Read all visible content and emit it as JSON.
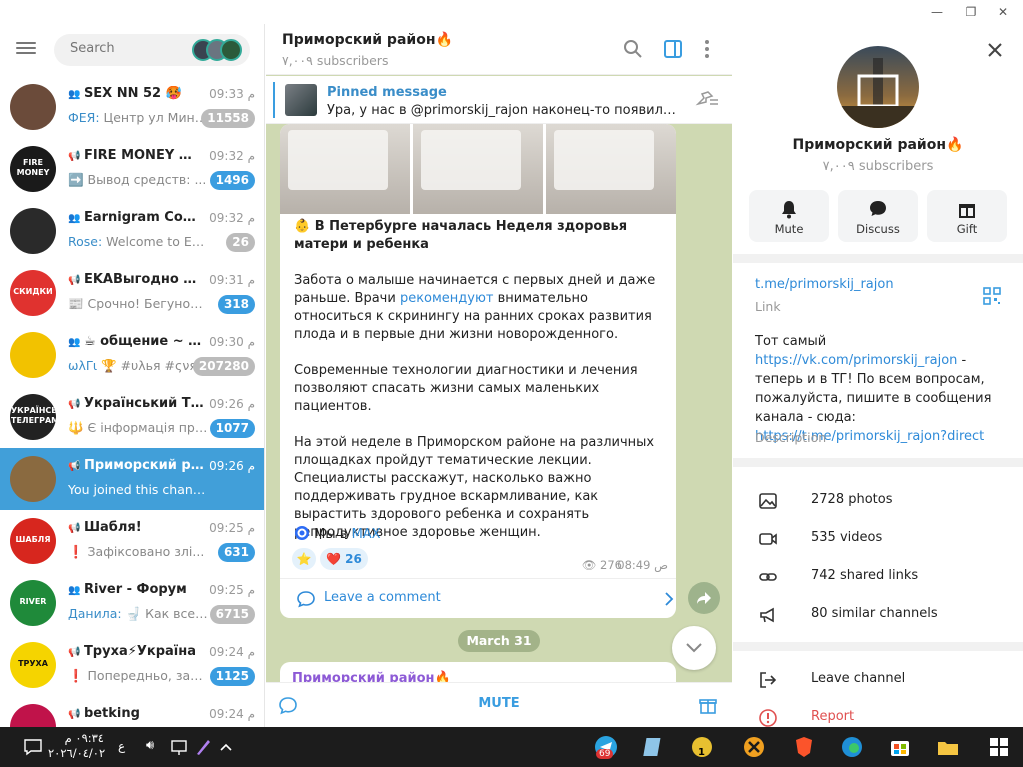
{
  "window": {
    "minimize": "—",
    "maximize": "❐",
    "close": "✕"
  },
  "sidebar": {
    "search_placeholder": "Search",
    "chats": [
      {
        "name": "SEX NN 52 🥵",
        "time": "09:33 م",
        "preview_sender": "ФЕЯ:",
        "preview": " Центр ул Мини...",
        "badge": "11558",
        "badge_style": "muted",
        "type": "group",
        "avatar_color": "#6b4b3a"
      },
      {
        "name": "FIRE MONEY фи...",
        "time": "09:32 م",
        "preview_sender": "",
        "preview": "➡️ Вывод средств: ...",
        "badge": "1496",
        "badge_style": "blue",
        "type": "channel",
        "avatar_color": "#1a1a1a"
      },
      {
        "name": "Earnigram Com...",
        "time": "09:32 م",
        "preview_sender": "Rose:",
        "preview": " Welcome to Earnig...",
        "badge": "26",
        "badge_style": "muted",
        "type": "group",
        "avatar_color": "#2a2a2a"
      },
      {
        "name": "EKAВыгодно Ск...",
        "time": "09:31 م",
        "preview_sender": "",
        "preview": "📰 Срочно! Бегунок в ...",
        "badge": "318",
        "badge_style": "blue",
        "type": "channel",
        "avatar_color": "#e0322f"
      },
      {
        "name": "☕ общение ~ D...",
        "time": "09:30 م",
        "preview_sender": "ωλΓι",
        "preview": " 🏆 #υλья #ςνя:",
        "badge": "207280",
        "badge_style": "muted",
        "type": "group",
        "avatar_color": "#f2c200"
      },
      {
        "name": "Український Тел...",
        "time": "09:26 م",
        "preview_sender": "",
        "preview": "🔱 Є інформація про ...",
        "badge": "1077",
        "badge_style": "blue",
        "type": "channel",
        "avatar_color": "#222"
      },
      {
        "name": "Приморский ра...",
        "time": "09:26 م",
        "preview_sender": "",
        "preview": "You joined this channel",
        "badge": "",
        "badge_style": "none",
        "type": "channel",
        "avatar_color": "#8a6a40",
        "active": true
      },
      {
        "name": "Шабля!",
        "time": "09:25 م",
        "preview_sender": "",
        "preview": "❗ Зафіксовано злі...",
        "badge": "631",
        "badge_style": "blue",
        "type": "channel",
        "avatar_color": "#d7261e"
      },
      {
        "name": "River - Форум",
        "time": "09:25 م",
        "preview_sender": "Данила:",
        "preview": " 🚽 Как всегд...",
        "badge": "6715",
        "badge_style": "muted",
        "type": "group",
        "avatar_color": "#1f8a3a"
      },
      {
        "name": "Труха⚡Україна",
        "time": "09:24 م",
        "preview_sender": "",
        "preview": "❗ Попередньо, зафі...",
        "badge": "1125",
        "badge_style": "blue",
        "type": "channel",
        "avatar_color": "#f5d400"
      },
      {
        "name": "betking",
        "time": "09:24 م",
        "preview_sender": "",
        "preview": "",
        "badge": "",
        "badge_style": "none",
        "type": "channel",
        "avatar_color": "#c0134a"
      }
    ],
    "avatar_labels": {
      "fire": "FIRE MONEY",
      "eka": "СКИДКИ",
      "ukr": "УКРАЇНСЬКИЙ ТЕЛЕГРАМ",
      "shablya": "ШАБЛЯ",
      "river": "RIVER",
      "truha": "ТРУХА"
    }
  },
  "channel": {
    "title": "Приморский район🔥",
    "subscribers": "٧,٠٠٩ subscribers",
    "pinned_title": "Pinned message",
    "pinned_text": "Ура, у нас в @primorskij_rajon наконец-то появились к...",
    "message": {
      "title": "👶 В Петербурге началась Неделя здоровья матери и ребенка",
      "p1_before": "Забота о малыше начинается с первых дней и даже раньше. Врачи ",
      "p1_link": "рекомендуют",
      "p1_after": " внимательно относиться к скринингу на ранних сроках развития плода и в первые дни жизни новорожденного.",
      "p2": "Современные технологии диагностики и лечения позволяют спасать жизни самых маленьких пациентов.",
      "p3": "На этой неделе в Приморском районе на различных площадках пройдут тематические лекции. Специалисты расскажут, насколько важно поддерживать грудное вскармливание, как вырастить здорового ребенка и сохранять репродуктивное здоровье женщин.",
      "max_prefix": "Мы в ",
      "max_link": "MAX",
      "reaction_count": "26",
      "views": "276",
      "time": "08:49 ص"
    },
    "comment_label": "Leave a comment",
    "date_pill": "March 31",
    "next_sender": "Приморский район🔥",
    "mute_label": "MUTE"
  },
  "info": {
    "title": "Приморский район🔥",
    "subscribers": "٧,٠٠٩ subscribers",
    "actions": [
      "Mute",
      "Discuss",
      "Gift"
    ],
    "link": "t.me/primorskij_rajon",
    "link_label": "Link",
    "desc_1": "Тот самый ",
    "desc_link1": "https://vk.com/primorskij_rajon",
    "desc_2": " - теперь и в ТГ! По всем вопросам, пожалуйста, пишите в сообщения канала - сюда: ",
    "desc_link2": "https://t.me/primorskij_rajon?direct",
    "desc_label": "Description",
    "media": [
      "2728 photos",
      "535 videos",
      "742 shared links",
      "80 similar channels"
    ],
    "leave": "Leave channel",
    "report": "Report"
  },
  "taskbar": {
    "time": "٠٩:٣٤ م",
    "date": "٢٠٢٦/٠٤/٠٢",
    "lang": "ع",
    "telegram_badge": "69",
    "app_badge": "1"
  },
  "colors": {
    "accent": "#419fd9",
    "link": "#2e8ad8",
    "chat_bg": "#cfd9b2"
  }
}
